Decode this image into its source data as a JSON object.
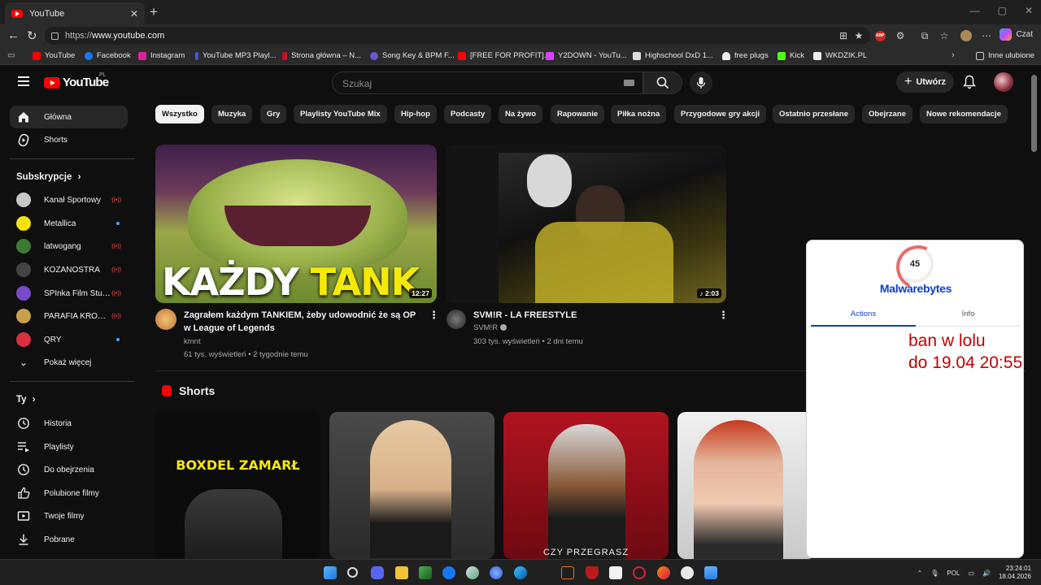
{
  "browser": {
    "tab_title": "YouTube",
    "url_scheme": "https://",
    "url_host": "www.youtube.com",
    "copilot_label": "Czat",
    "bookmarks": [
      {
        "label": "YouTube",
        "color": "#ff0000"
      },
      {
        "label": "Facebook",
        "color": "#1877f2"
      },
      {
        "label": "Instagram",
        "color": "#d6249f"
      },
      {
        "label": "YouTube MP3 Playl...",
        "color": "#3a5bd9"
      },
      {
        "label": "Strona główna – N...",
        "color": "#c1121f"
      },
      {
        "label": "Song Key & BPM F...",
        "color": "#6a5acd"
      },
      {
        "label": "[FREE FOR PROFIT]...",
        "color": "#ff0000"
      },
      {
        "label": "Y2DOWN - YouTu...",
        "color": "#e040fb"
      },
      {
        "label": "Highschool DxD 1...",
        "color": "#dddddd"
      },
      {
        "label": "free plugs",
        "color": "#eeeeee"
      },
      {
        "label": "Kick",
        "color": "#53fc18"
      },
      {
        "label": "WKDZIK.PL",
        "color": "#eeeeee"
      }
    ],
    "other_favorites": "Inne ulubione"
  },
  "youtube": {
    "logo_text": "YouTube",
    "logo_region": "PL",
    "search_placeholder": "Szukaj",
    "create_label": "Utwórz",
    "sidebar": {
      "main": [
        {
          "label": "Główna",
          "icon": "home-icon",
          "active": true
        },
        {
          "label": "Shorts",
          "icon": "shorts-icon",
          "active": false
        }
      ],
      "subscriptions_header": "Subskrypcje",
      "subscriptions": [
        {
          "label": "Kanał Sportowy",
          "indicator": "live",
          "color": "#c7c7c7"
        },
        {
          "label": "Metallica",
          "indicator": "new",
          "color": "#f5e211"
        },
        {
          "label": "latwogang",
          "indicator": "live",
          "color": "#3b7a33"
        },
        {
          "label": "KOZANOSTRA",
          "indicator": "live",
          "color": "#444444"
        },
        {
          "label": "SPInka Film Stud...",
          "indicator": "live",
          "color": "#7a4bc9"
        },
        {
          "label": "PARAFIA KROBIA",
          "indicator": "live",
          "color": "#c9a04b"
        },
        {
          "label": "QRY",
          "indicator": "new",
          "color": "#d9303e"
        }
      ],
      "show_more": "Pokaż więcej",
      "you_header": "Ty",
      "you_items": [
        {
          "label": "Historia",
          "icon": "history-icon"
        },
        {
          "label": "Playlisty",
          "icon": "playlists-icon"
        },
        {
          "label": "Do obejrzenia",
          "icon": "watch-later-icon"
        },
        {
          "label": "Polubione filmy",
          "icon": "liked-icon"
        },
        {
          "label": "Twoje filmy",
          "icon": "your-videos-icon"
        },
        {
          "label": "Pobrane",
          "icon": "download-icon"
        }
      ]
    },
    "chips": [
      "Wszystko",
      "Muzyka",
      "Gry",
      "Playlisty YouTube Mix",
      "Hip-hop",
      "Podcasty",
      "Na żywo",
      "Rapowanie",
      "Piłka nożna",
      "Przygodowe gry akcji",
      "Ostatnio przesłane",
      "Obejrzane",
      "Nowe rekomendacje"
    ],
    "videos": [
      {
        "thumb_text_1": "KAŻDY",
        "thumb_text_2": "TANK",
        "duration": "12:27",
        "title": "Zagrałem każdym TANKIEM, żeby udowodnić że są OP w League of Legends",
        "channel": "kmnt",
        "meta": "61 tys. wyświetleń • 2 tygodnie temu"
      },
      {
        "duration": "2:03",
        "title": "SVM!R - LA FREESTYLE",
        "channel": "SVM!R",
        "meta": "303 tys. wyświetleń • 2 dni temu"
      }
    ],
    "shorts_title": "Shorts",
    "shorts": [
      {
        "caption": "BOXDEL ZAMARŁ"
      },
      {
        "caption": ""
      },
      {
        "caption": "CZY PRZEGRASZ"
      },
      {
        "caption": ""
      }
    ]
  },
  "malwarebytes": {
    "score": "45",
    "brand": "Malwarebytes",
    "tabs": [
      "Actions",
      "Info"
    ]
  },
  "overlay_note": {
    "line1": "ban w lolu",
    "line2": "do 19.04 20:55"
  },
  "taskbar": {
    "lang": "POL",
    "time": "23:24:01",
    "date": "18.04.2026"
  }
}
